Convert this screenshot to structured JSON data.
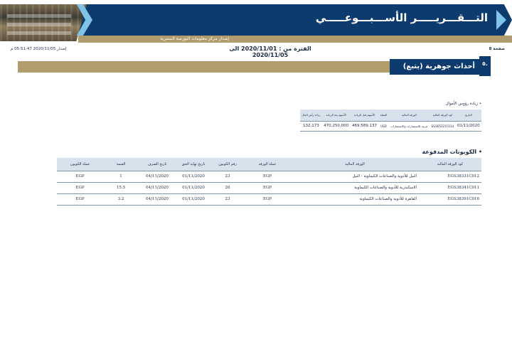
{
  "header": {
    "title": "التـــقـــريـــــر الأســـبـــوعـــــي",
    "subtitle": "إصدار مركز معلومات البورصة المصرية"
  },
  "info": {
    "page_label": "صفحة 8",
    "period": "الفترة من : 2020/11/01 الى 2020/11/05",
    "issue_label": "إصدار 2020/11/05 05:51:47 م"
  },
  "section": {
    "number": "٥.",
    "title": "أحداث جوهرية (يتبع)"
  },
  "capital_increase": {
    "title": "• زيادة رؤوس الأموال",
    "columns": [
      "التاريخ",
      "كود الورقة المالية",
      "الورقة المالية",
      "العملة",
      "الأسهم قبل الزيادة",
      "الأسهم بعد الزيادة",
      "زيادة رأس المال"
    ],
    "rows": [
      [
        "01/11/2020",
        "EGS65321C014",
        "عربية للاستثمارات والاستثمارات",
        "USD",
        "469,589,137",
        "470,250,000",
        "132,173"
      ]
    ]
  },
  "coupons": {
    "title": "• الكوبونات المدفوعة",
    "columns": [
      "كود الورقة المالية",
      "الورقة المالية",
      "عملة الورقة",
      "رقم الكوبون",
      "تاريخ نهاية الحق",
      "تاريخ الصرف",
      "القيمة",
      "عملة الكوبون"
    ],
    "rows": [
      [
        "EGS38331C012",
        "النيل للأدوية والصناعات الكيماوية - النيل",
        "EGP",
        "23",
        "01/11/2020",
        "04/11/2020",
        "1",
        "EGP"
      ],
      [
        "EGS38341C011",
        "الاسكندرية للأدوية والصناعات الكيماوية",
        "EGP",
        "26",
        "01/11/2020",
        "04/11/2020",
        "15.5",
        "EGP"
      ],
      [
        "EGS38391C016",
        "القاهرة للأدوية والصناعات الكيماوية",
        "EGP",
        "23",
        "01/11/2020",
        "04/11/2020",
        "3.2",
        "EGP"
      ]
    ]
  },
  "colors": {
    "navy": "#0e3b6e",
    "gold": "#b19c6d",
    "light_blue": "#7fc3e8",
    "table_header": "#d8e2ec"
  }
}
